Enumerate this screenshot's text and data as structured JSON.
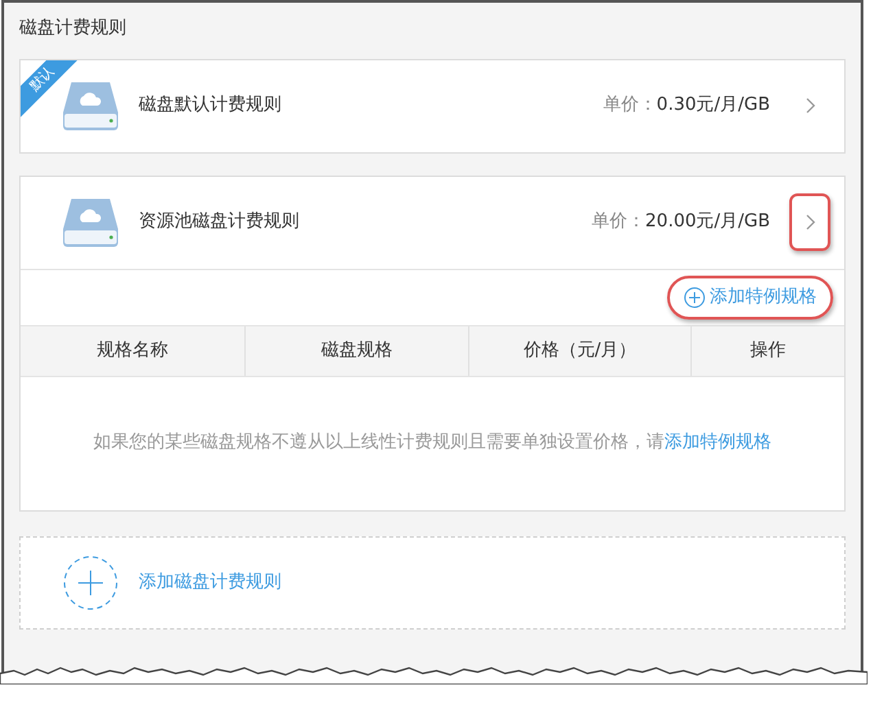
{
  "section_title": "磁盘计费规则",
  "rules": [
    {
      "badge": "默认",
      "name": "磁盘默认计费规则",
      "price_label": "单价：",
      "price_value": "0.30元/月/GB",
      "chevron_highlighted": false
    },
    {
      "name": "资源池磁盘计费规则",
      "price_label": "单价：",
      "price_value": "20.00元/月/GB",
      "chevron_highlighted": true,
      "add_special": {
        "label": "添加特例规格",
        "highlighted": true
      },
      "table": {
        "columns": [
          "规格名称",
          "磁盘规格",
          "价格（元/月）",
          "操作"
        ],
        "empty_message": "如果您的某些磁盘规格不遵从以上线性计费规则且需要单独设置价格，请",
        "empty_link": "添加特例规格"
      }
    }
  ],
  "add_rule": {
    "label": "添加磁盘计费规则"
  }
}
